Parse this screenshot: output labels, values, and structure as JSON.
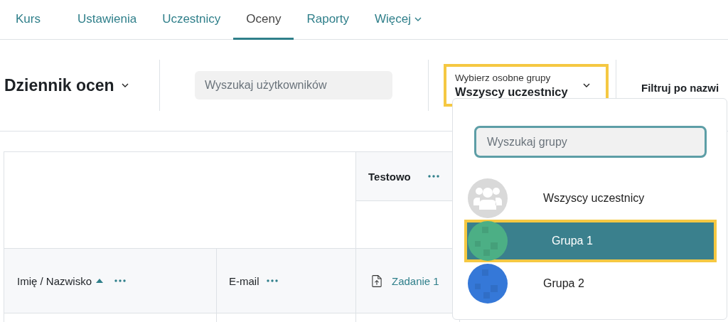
{
  "tabs": [
    {
      "label": "Kurs",
      "selected": false,
      "has_menu": false
    },
    {
      "label": "Ustawienia",
      "selected": false,
      "has_menu": false
    },
    {
      "label": "Uczestnicy",
      "selected": false,
      "has_menu": false
    },
    {
      "label": "Oceny",
      "selected": true,
      "has_menu": false
    },
    {
      "label": "Raporty",
      "selected": false,
      "has_menu": false
    },
    {
      "label": "Więcej",
      "selected": false,
      "has_menu": true
    }
  ],
  "header": {
    "title": "Dziennik ocen",
    "user_search": {
      "placeholder": "Wyszukaj użytkowników"
    },
    "group_selector": {
      "label": "Wybierz osobne grupy",
      "value": "Wszyscy uczestnicy",
      "highlighted": true,
      "expanded": true
    },
    "filter_label": "Filtruj po nazwi"
  },
  "group_menu": {
    "search": {
      "placeholder": "Wyszukaj grupy"
    },
    "items": [
      {
        "label": "Wszyscy uczestnicy",
        "kind": "all",
        "selected": false,
        "highlighted": false
      },
      {
        "label": "Grupa 1",
        "kind": "picture",
        "color": "#4caf85",
        "selected": true,
        "highlighted": true
      },
      {
        "label": "Grupa 2",
        "kind": "picture",
        "color": "#3578d8",
        "selected": false,
        "highlighted": false
      }
    ]
  },
  "table": {
    "category": "Testowo",
    "columns": [
      {
        "label": "Imię / Nazwisko",
        "sorted": true,
        "kind": "text"
      },
      {
        "label": "E-mail",
        "sorted": false,
        "kind": "text"
      },
      {
        "label": "Zadanie 1",
        "sorted": false,
        "kind": "assignment"
      }
    ]
  }
}
